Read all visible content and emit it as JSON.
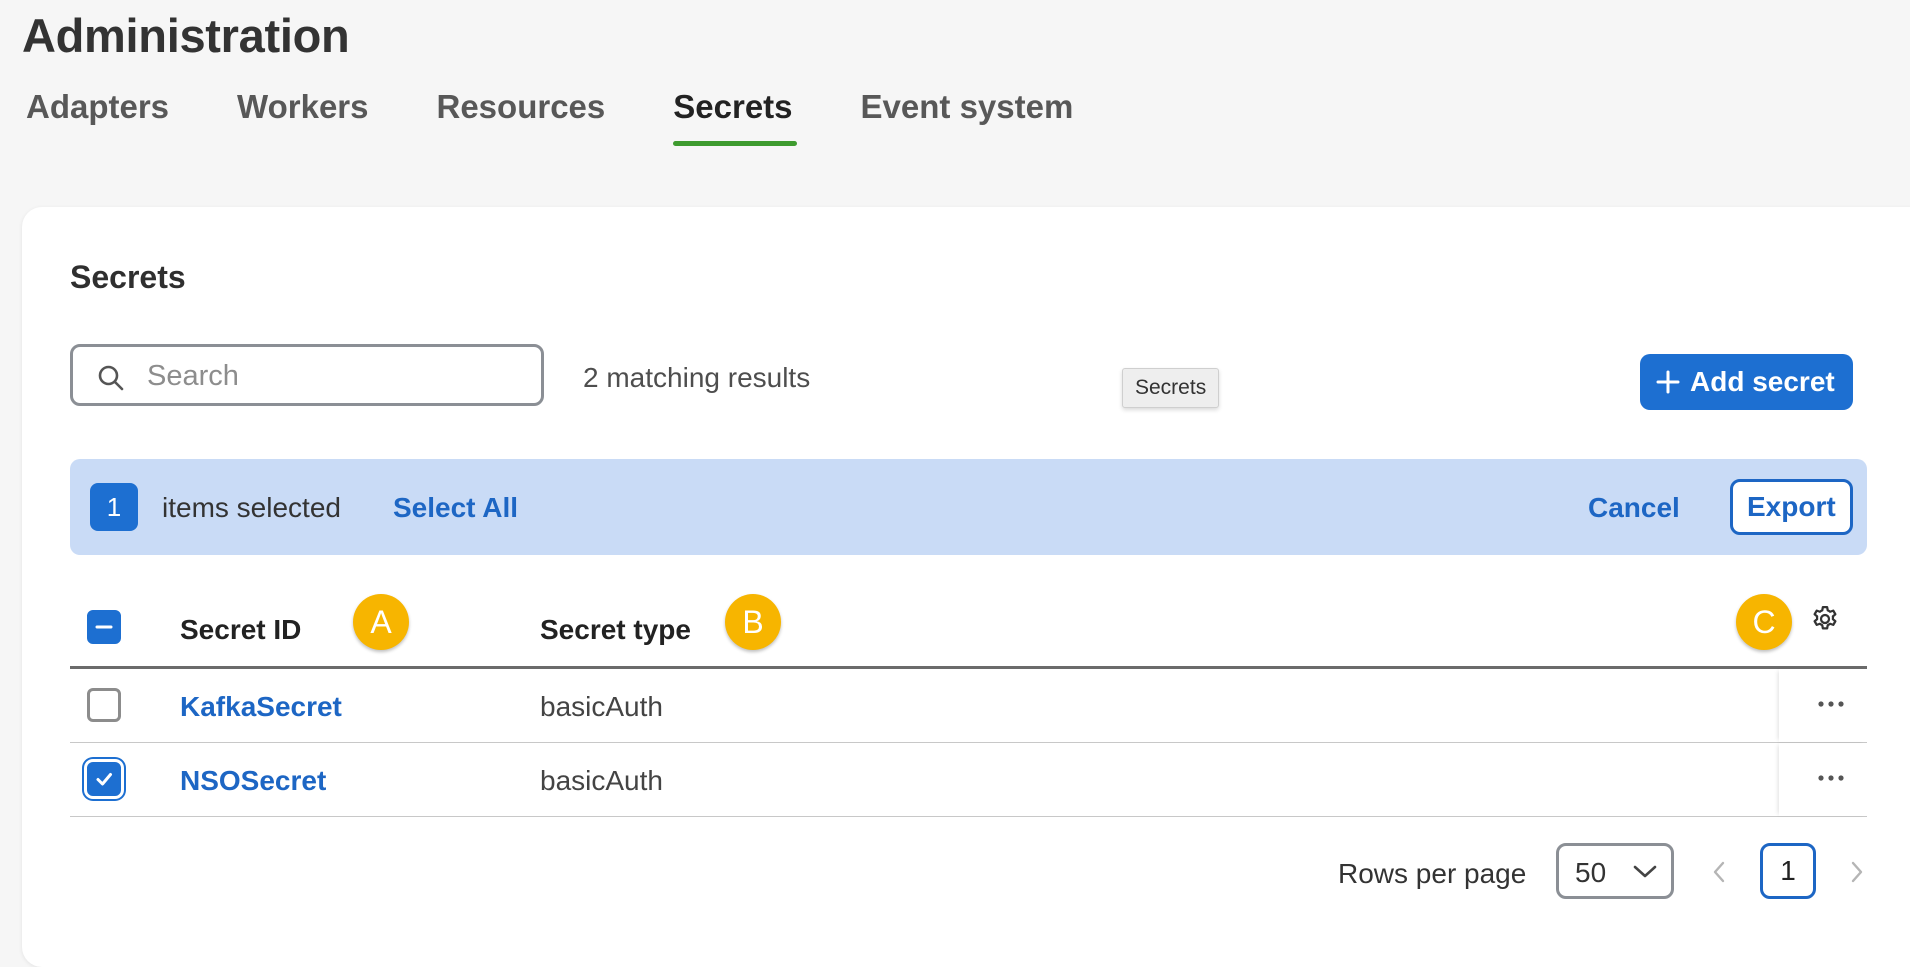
{
  "page": {
    "title": "Administration"
  },
  "tabs": [
    {
      "label": "Adapters"
    },
    {
      "label": "Workers"
    },
    {
      "label": "Resources"
    },
    {
      "label": "Secrets"
    },
    {
      "label": "Event system"
    }
  ],
  "active_tab": "Secrets",
  "card": {
    "title": "Secrets"
  },
  "search": {
    "placeholder": "Search",
    "value": ""
  },
  "results": {
    "text": "2 matching results"
  },
  "tooltip": {
    "text": "Secrets"
  },
  "add_button": {
    "label": "Add secret",
    "icon": "plus-icon"
  },
  "selection": {
    "count": "1",
    "label": "items selected",
    "select_all": "Select All",
    "cancel": "Cancel",
    "export": "Export"
  },
  "table": {
    "columns": [
      "Secret ID",
      "Secret type"
    ],
    "markers": [
      "A",
      "B",
      "C"
    ],
    "rows": [
      {
        "id": "KafkaSecret",
        "type": "basicAuth",
        "checked": false
      },
      {
        "id": "NSOSecret",
        "type": "basicAuth",
        "checked": true
      }
    ]
  },
  "pagination": {
    "rows_label": "Rows per page",
    "rows_value": "50",
    "page": "1"
  },
  "colors": {
    "primary": "#1d6fd1",
    "tab_underline": "#3e9b2f",
    "selection_bar": "#c9dbf6",
    "marker": "#f7b500"
  }
}
